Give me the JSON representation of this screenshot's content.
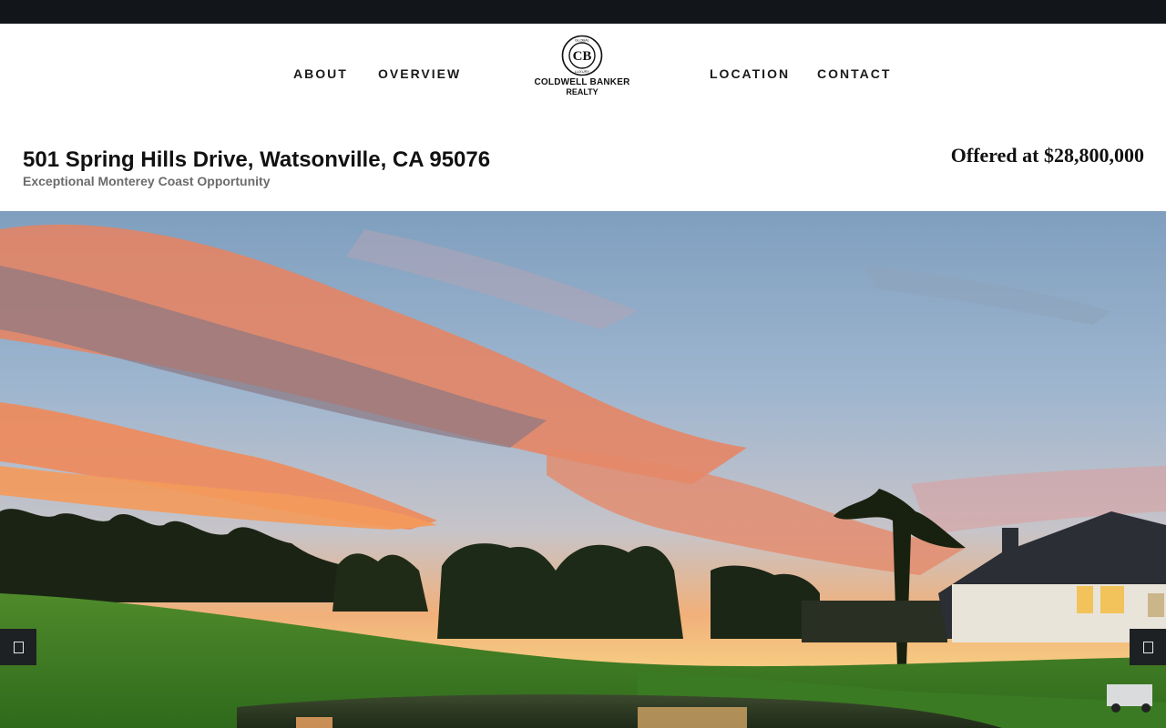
{
  "nav": {
    "left": [
      {
        "label": "ABOUT"
      },
      {
        "label": "OVERVIEW"
      }
    ],
    "right": [
      {
        "label": "LOCATION"
      },
      {
        "label": "CONTACT"
      }
    ]
  },
  "logo": {
    "ring_text": "GLOBAL LUXURY",
    "monogram": "CB",
    "brand": "COLDWELL BANKER",
    "sub": "REALTY"
  },
  "listing": {
    "address": "501 Spring Hills Drive, Watsonville, CA 95076",
    "tagline": "Exceptional Monterey Coast Opportunity",
    "price": "Offered at $28,800,000"
  },
  "hero": {
    "icon_prev": "slider-prev-icon",
    "icon_next": "slider-next-icon"
  },
  "colors": {
    "topbar": "#121519",
    "text": "#111111",
    "tagline": "#6b6b6b",
    "slider_button": "#1e2124"
  }
}
